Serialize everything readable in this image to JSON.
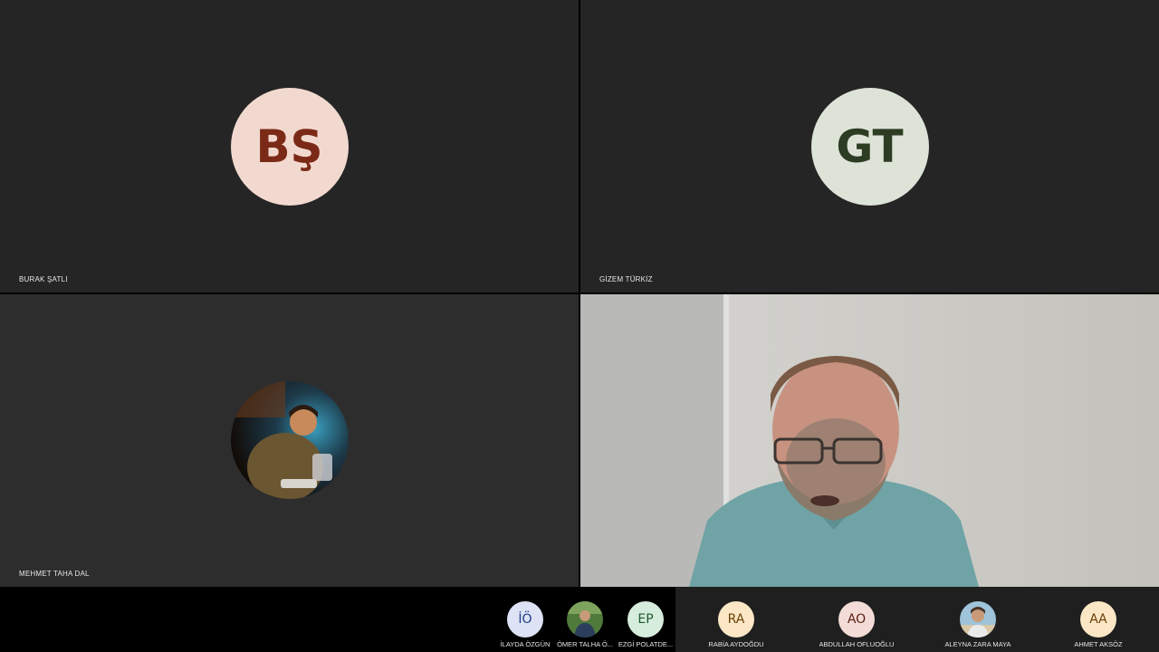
{
  "tiles": [
    {
      "name": "BURAK ŞATLI",
      "initials": "BŞ"
    },
    {
      "name": "GİZEM TÜRKİZ",
      "initials": "GT"
    },
    {
      "name": "MEHMET TAHA DAL"
    },
    {
      "name": ""
    }
  ],
  "participants": [
    {
      "name": "İLAYDA ÖZGÜN",
      "initials": "İÖ",
      "color": "#dde3f4",
      "text": "#1f3c88"
    },
    {
      "name": "ÖMER TALHA Ö...",
      "photo": "photo"
    },
    {
      "name": "EZGİ POLATDE...",
      "initials": "EP",
      "color": "#d6ecdc",
      "text": "#1c5a30"
    },
    {
      "name": "RABİA AYDOĞDU",
      "initials": "RA",
      "color": "#fbe7c6",
      "text": "#6b3f07"
    },
    {
      "name": "ABDULLAH OFLUOĞLU",
      "initials": "AO",
      "color": "#f3dcd7",
      "text": "#5a1e12"
    },
    {
      "name": "ALEYNA ZARA MAYA",
      "photo": "photo"
    },
    {
      "name": "AHMET AKSÖZ",
      "initials": "AA",
      "color": "#fbe7c6",
      "text": "#6b3f07"
    }
  ]
}
